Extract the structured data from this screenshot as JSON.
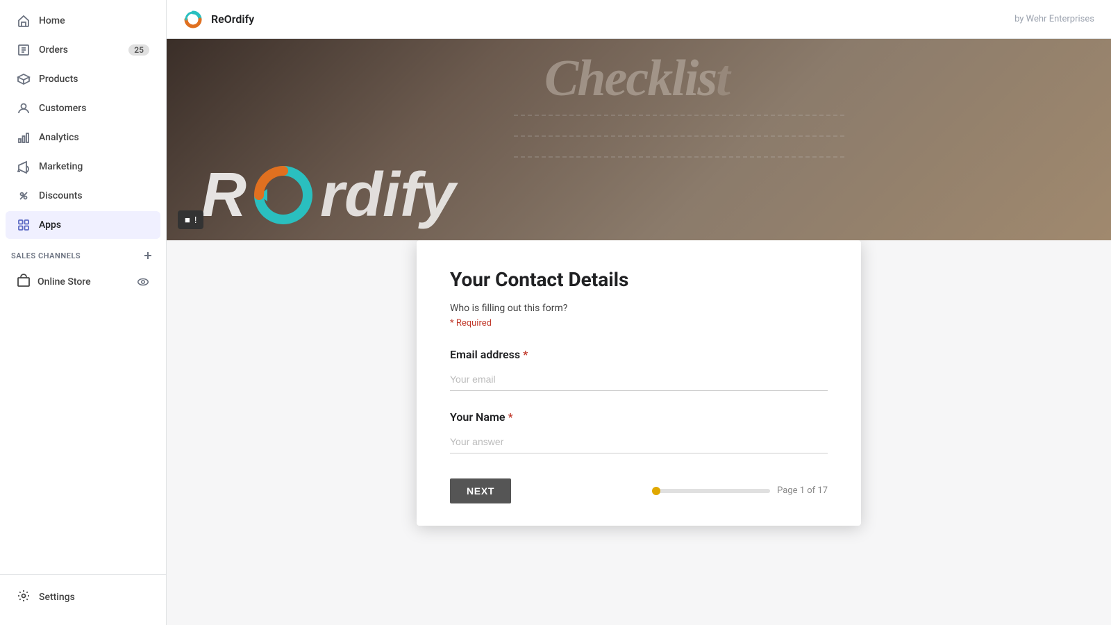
{
  "topbar": {
    "app_name": "ReOrdify",
    "by_label": "by Wehr Enterprises"
  },
  "sidebar": {
    "nav_items": [
      {
        "id": "home",
        "label": "Home",
        "icon": "home-icon",
        "badge": null,
        "active": false
      },
      {
        "id": "orders",
        "label": "Orders",
        "icon": "orders-icon",
        "badge": "25",
        "active": false
      },
      {
        "id": "products",
        "label": "Products",
        "icon": "products-icon",
        "badge": null,
        "active": false
      },
      {
        "id": "customers",
        "label": "Customers",
        "icon": "customers-icon",
        "badge": null,
        "active": false
      },
      {
        "id": "analytics",
        "label": "Analytics",
        "icon": "analytics-icon",
        "badge": null,
        "active": false
      },
      {
        "id": "marketing",
        "label": "Marketing",
        "icon": "marketing-icon",
        "badge": null,
        "active": false
      },
      {
        "id": "discounts",
        "label": "Discounts",
        "icon": "discounts-icon",
        "badge": null,
        "active": false
      },
      {
        "id": "apps",
        "label": "Apps",
        "icon": "apps-icon",
        "badge": null,
        "active": true
      }
    ],
    "sales_channels_label": "SALES CHANNELS",
    "online_store_label": "Online Store",
    "settings_label": "Settings"
  },
  "modal": {
    "title": "Your Contact Details",
    "subtitle": "Who is filling out this form?",
    "required_label": "* Required",
    "email_field": {
      "label": "Email address",
      "required": true,
      "placeholder": "Your email"
    },
    "name_field": {
      "label": "Your Name",
      "required": true,
      "placeholder": "Your answer"
    },
    "next_button_label": "NEXT",
    "page_indicator": "Page 1 of 17"
  },
  "feedback": {
    "icon": "feedback-icon",
    "label": "!"
  }
}
